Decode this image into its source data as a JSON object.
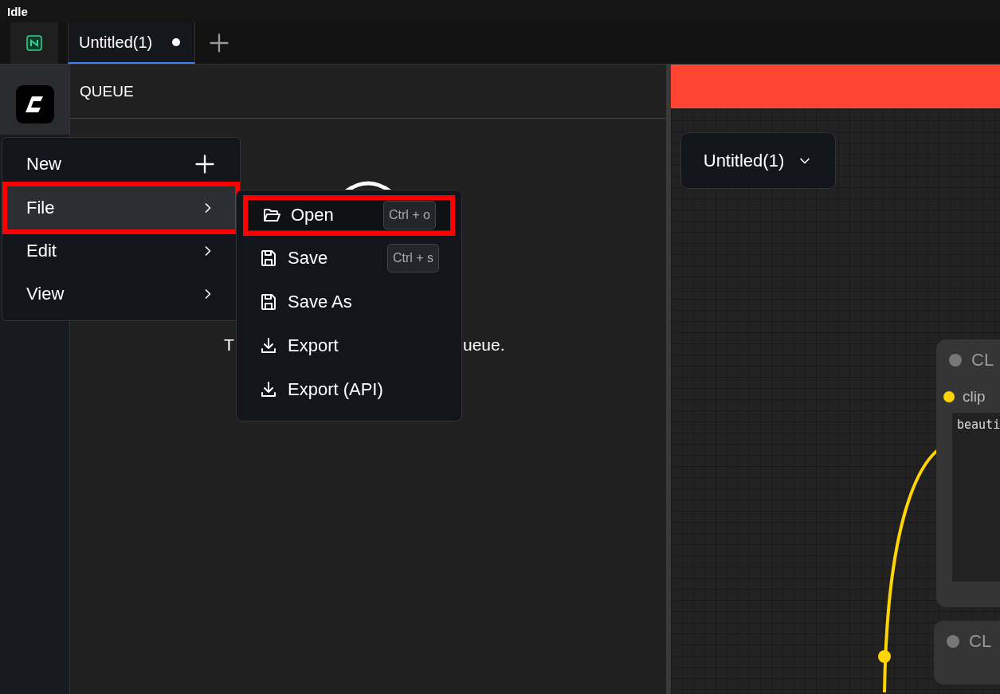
{
  "status": "Idle",
  "tabs": [
    {
      "label": "Untitled(1)",
      "selected": true,
      "unsaved": true
    }
  ],
  "queue": {
    "title": "QUEUE",
    "message_start": "T",
    "message_end": "ueue."
  },
  "menu": [
    {
      "label": "New",
      "kind": "action",
      "highlighted": false
    },
    {
      "label": "File",
      "kind": "submenu",
      "highlighted": true
    },
    {
      "label": "Edit",
      "kind": "submenu",
      "highlighted": false
    },
    {
      "label": "View",
      "kind": "submenu",
      "highlighted": false
    }
  ],
  "submenu": [
    {
      "label": "Open",
      "kind": "open",
      "shortcut": "Ctrl + o",
      "highlighted": true
    },
    {
      "label": "Save",
      "kind": "save",
      "shortcut": "Ctrl + s",
      "highlighted": false
    },
    {
      "label": "Save As",
      "kind": "save",
      "highlighted": false
    },
    {
      "label": "Export",
      "kind": "export",
      "highlighted": false
    },
    {
      "label": "Export (API)",
      "kind": "export",
      "highlighted": false
    }
  ],
  "workflow_button": {
    "label": "Untitled(1)"
  },
  "nodes": [
    {
      "title": "CL",
      "input": "clip",
      "text": "beauti"
    },
    {
      "title": "CL"
    }
  ]
}
